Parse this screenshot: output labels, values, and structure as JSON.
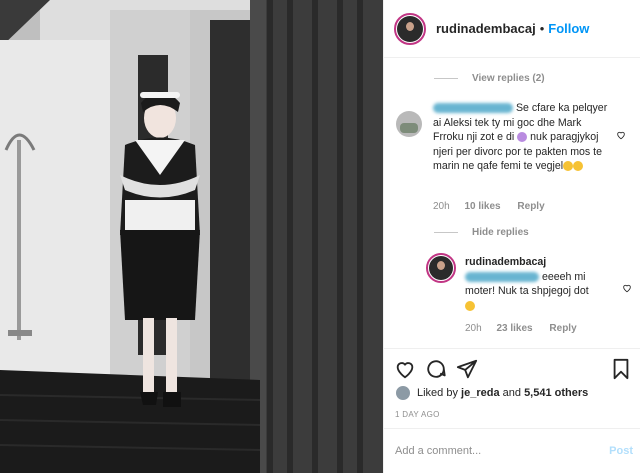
{
  "post": {
    "username": "rudinadembacaj",
    "separator": "•",
    "follow_label": "Follow"
  },
  "comments": {
    "view_replies": "View replies (2)",
    "comment1": {
      "text": "Se cfare ka pelqyer ai Aleksi tek ty mi goc dhe Mark Frroku nji zot e di",
      "text2": "nuk paragjykoj njeri per divorc por te pakten mos te marin ne qafe femi te vegjel",
      "time": "20h",
      "likes": "10 likes",
      "reply": "Reply"
    },
    "hide_replies": "Hide replies",
    "reply1": {
      "username": "rudinadembacaj",
      "text": "eeeeh mi moter! Nuk ta shpjegoj dot",
      "time": "20h",
      "likes": "23 likes",
      "reply": "Reply"
    }
  },
  "footer": {
    "liked_by_prefix": "Liked by",
    "liked_by_user": "je_reda",
    "liked_by_and": "and",
    "liked_by_count": "5,541 others",
    "date": "1 DAY AGO",
    "add_comment_placeholder": "Add a comment...",
    "post_label": "Post"
  },
  "icons": {
    "like": "heart-icon",
    "comment": "comment-icon",
    "share": "share-icon",
    "save": "bookmark-icon"
  },
  "colors": {
    "accent": "#0095f6",
    "ring": "#c13584",
    "muted": "#8e8e8e"
  }
}
